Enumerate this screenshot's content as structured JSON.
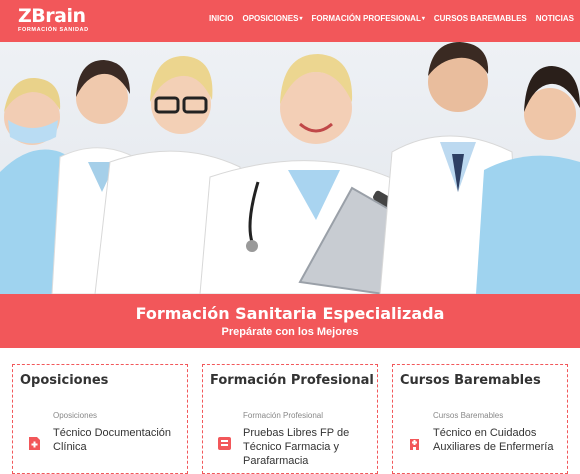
{
  "brand": {
    "name": "ZBrain",
    "tagline": "FORMACIÓN SANIDAD",
    "accent": "#f2575a"
  },
  "nav": [
    {
      "label": "INICIO",
      "dropdown": false
    },
    {
      "label": "OPOSICIONES",
      "dropdown": true
    },
    {
      "label": "FORMACIÓN PROFESIONAL",
      "dropdown": true
    },
    {
      "label": "CURSOS BAREMABLES",
      "dropdown": false
    },
    {
      "label": "NOTICIAS",
      "dropdown": false
    }
  ],
  "banner": {
    "title": "Formación Sanitaria Especializada",
    "subtitle": "Prepárate con los Mejores"
  },
  "cards": [
    {
      "title": "Oposiciones",
      "category": "Oposiciones",
      "item": "Técnico Documentación Clínica",
      "icon": "medical-file-icon"
    },
    {
      "title": "Formación Profesional",
      "category": "Formación Profesional",
      "item": "Pruebas Libres FP de Técnico Farmacia y Parafarmacia",
      "icon": "medical-box-icon"
    },
    {
      "title": "Cursos Baremables",
      "category": "Cursos Baremables",
      "item": "Técnico en Cuidados Auxiliares de Enfermería",
      "icon": "hospital-icon"
    }
  ]
}
